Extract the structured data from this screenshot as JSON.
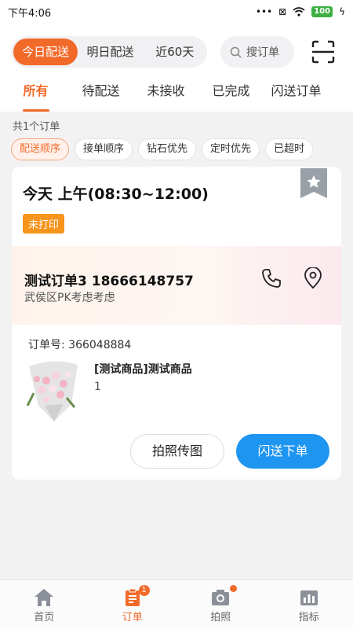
{
  "status_bar": {
    "time": "下午4:06",
    "battery": "100"
  },
  "header": {
    "segments": [
      "今日配送",
      "明日配送",
      "近60天"
    ],
    "search_placeholder": "搜订单"
  },
  "tabs": [
    "所有",
    "待配送",
    "未接收",
    "已完成",
    "闪送订单"
  ],
  "order_count": "共1个订单",
  "filters": [
    "配送顺序",
    "接单顺序",
    "钻石优先",
    "定时优先",
    "已超时"
  ],
  "order": {
    "time_window": "今天 上午(08:30~12:00)",
    "print_tag": "未打印",
    "customer_line": "测试订单3  18666148757",
    "address": "武侯区PK考虑考虑",
    "order_no": "订单号: 366048884",
    "product_name": "[测试商品]测试商品",
    "product_qty": "1",
    "btn_photo": "拍照传图",
    "btn_send": "闪送下单"
  },
  "bottom_nav": [
    {
      "label": "首页",
      "icon": "home-icon"
    },
    {
      "label": "订单",
      "icon": "clipboard-icon",
      "badge": "1"
    },
    {
      "label": "拍照",
      "icon": "camera-icon"
    },
    {
      "label": "指标",
      "icon": "chart-icon"
    }
  ],
  "colors": {
    "accent": "#f26a2a",
    "primary_blue": "#1e95f0",
    "tag_orange": "#f7941d"
  }
}
